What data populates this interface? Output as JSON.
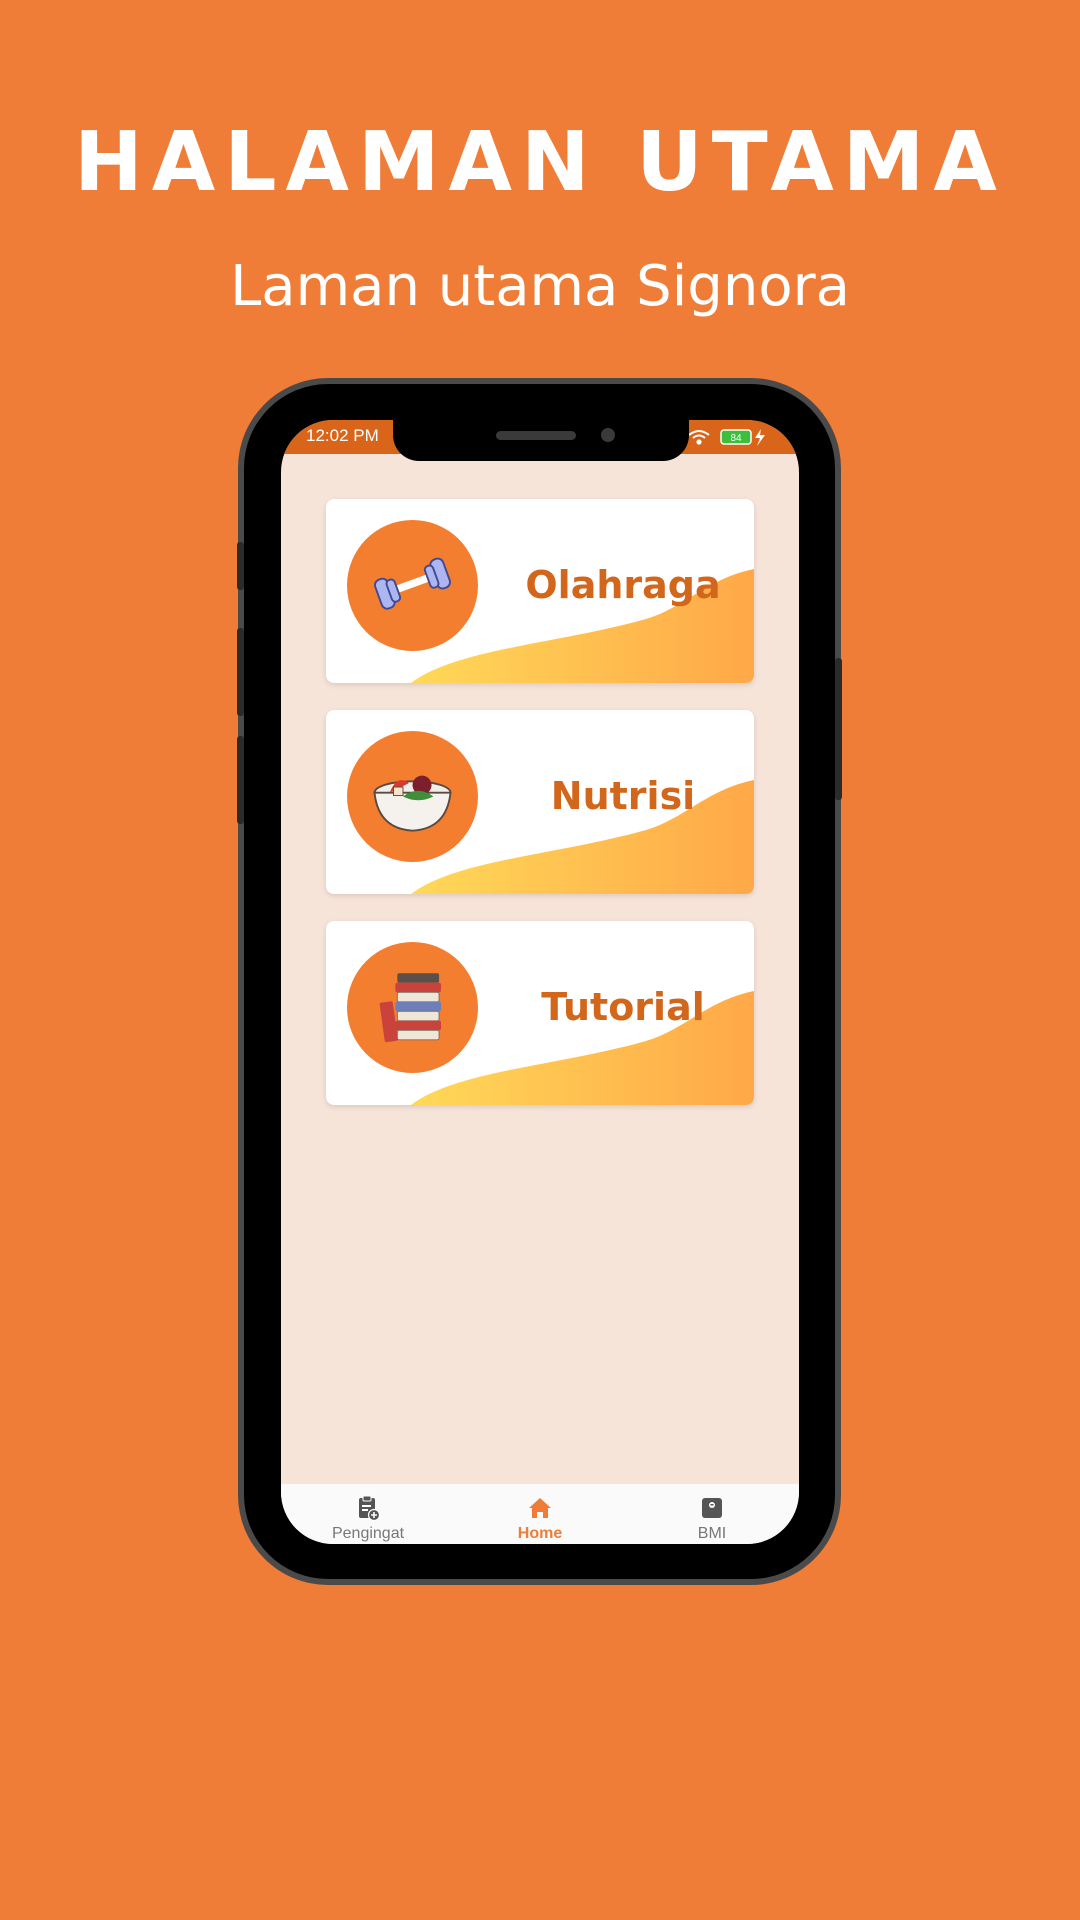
{
  "headline": "HALAMAN UTAMA",
  "subheadline": "Laman utama Signora",
  "status": {
    "time": "12:02 PM",
    "battery": "84"
  },
  "cards": [
    {
      "label": "Olahraga",
      "icon": "dumbbell-icon"
    },
    {
      "label": "Nutrisi",
      "icon": "food-bowl-icon"
    },
    {
      "label": "Tutorial",
      "icon": "books-icon"
    }
  ],
  "nav": [
    {
      "label": "Pengingat",
      "icon": "clipboard-add-icon",
      "active": false
    },
    {
      "label": "Home",
      "icon": "home-icon",
      "active": true
    },
    {
      "label": "BMI",
      "icon": "scale-icon",
      "active": false
    }
  ],
  "colors": {
    "background": "#EF7D38",
    "accent": "#D2661B",
    "screen": "#F7E4D9"
  }
}
